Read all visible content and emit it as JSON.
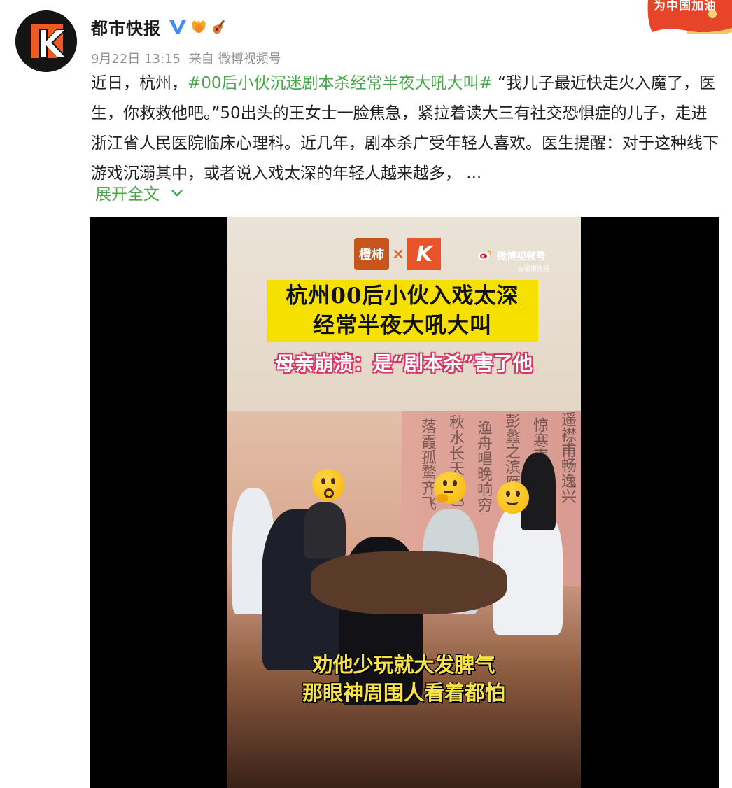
{
  "user": {
    "name": "都市快报",
    "time": "9月22日 13:15",
    "source_prefix": "来自",
    "source": "微博视频号"
  },
  "corner_banner": "为中国加油",
  "post": {
    "text_before": "近日，杭州，",
    "hashtag": "#00后小伙沉迷剧本杀经常半夜大吼大叫#",
    "text_after": " “我儿子最近快走火入魔了，医生，你救救他吧。”50出头的王女士一脸焦急，紧拉着读大三有社交恐惧症的儿子，走进浙江省人民医院临床心理科。近几年，剧本杀广受年轻人喜欢。医生提醒：对于这种线下游戏沉溺其中，或者说入戏太深的年轻人越来越多， ...",
    "expand_label": "展开全文"
  },
  "video": {
    "logo_left": "橙柿",
    "logo_x": "×",
    "logo_k": "K",
    "watermark_main": "微博视频号",
    "watermark_sub": "@都市快报",
    "headline_line1": "杭州00后小伙入戏太深",
    "headline_line2": "经常半夜大吼大叫",
    "subhead": "母亲崩溃：是“剧本杀”害了他",
    "caption_line1": "劝他少玩就大发脾气",
    "caption_line2": "那眼神周围人看着都怕"
  },
  "colors": {
    "hashtag": "#4aa64a",
    "headline_bg": "#f6e000",
    "caption": "#f8e24a",
    "verified": "#3d8ef0"
  }
}
